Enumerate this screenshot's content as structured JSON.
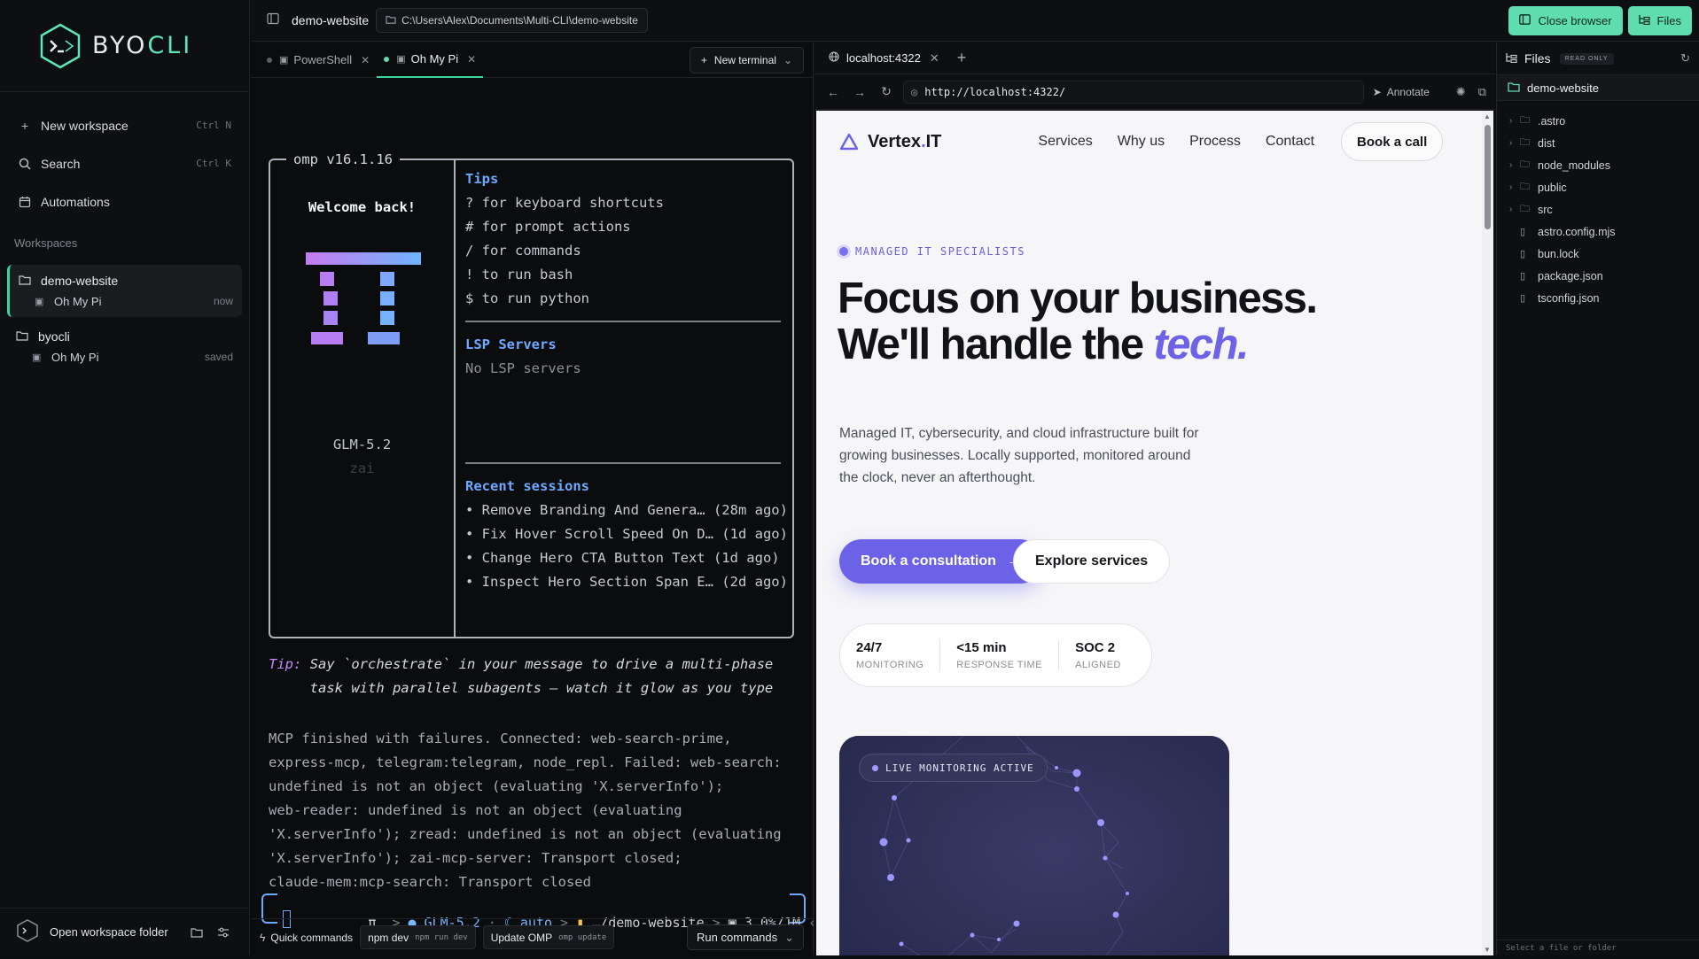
{
  "brand": {
    "name": "BYOCLI",
    "name_main": "BYO",
    "name_accent": "CLI",
    "accent_color": "#5ee6b7"
  },
  "sidebar": {
    "menu": [
      {
        "label": "New workspace",
        "shortcut": "Ctrl N",
        "icon": "plus-icon"
      },
      {
        "label": "Search",
        "shortcut": "Ctrl K",
        "icon": "search-icon"
      },
      {
        "label": "Automations",
        "shortcut": "",
        "icon": "calendar-icon"
      }
    ],
    "section_title": "Workspaces",
    "workspaces": [
      {
        "name": "demo-website",
        "session": "Oh My Pi",
        "meta": "now",
        "active": true
      },
      {
        "name": "byocli",
        "session": "Oh My Pi",
        "meta": "saved",
        "active": false
      }
    ],
    "footer_label": "Open workspace folder"
  },
  "topbar": {
    "project": "demo-website",
    "path": "C:\\Users\\Alex\\Documents\\Multi-CLI\\demo-website",
    "close_browser": "Close browser",
    "files": "Files"
  },
  "terminal": {
    "tabs": [
      {
        "label": "PowerShell",
        "active": false
      },
      {
        "label": "Oh My Pi",
        "active": true
      }
    ],
    "new_terminal": "New terminal",
    "box_title": "omp v16.1.16",
    "welcome": "Welcome back!",
    "model": "GLM-5.2",
    "provider": "zai",
    "tips_title": "Tips",
    "tips": [
      "? for keyboard shortcuts",
      "# for prompt actions",
      "/ for commands",
      "! to run bash",
      "$ to run python"
    ],
    "lsp_title": "LSP Servers",
    "lsp_none": "No LSP servers",
    "recent_title": "Recent sessions",
    "recent": [
      "• Remove Branding And Genera… (28m ago)",
      "• Fix Hover Scroll Speed On D… (1d ago)",
      "• Change Hero CTA Button Text (1d ago)",
      "• Inspect Hero Section Span E… (2d ago)"
    ],
    "tip_label": "Tip:",
    "tip_line1": " Say `orchestrate` in your message to drive a multi-phase",
    "tip_line2": "     task with parallel subagents — watch it glow as you type",
    "mcp_lines": [
      "MCP finished with failures. Connected: web-search-prime,",
      "express-mcp, telegram:telegram, node_repl. Failed: web-search:",
      "undefined is not an object (evaluating 'X.serverInfo');",
      "web-reader: undefined is not an object (evaluating",
      "'X.serverInfo'); zread: undefined is not an object (evaluating",
      "'X.serverInfo'); zai-mcp-server: Transport closed;",
      "claude-mem:mcp-search: Transport closed"
    ],
    "status": {
      "pi": "π",
      "model": "GLM-5.2",
      "mode": "auto",
      "dir": "…/demo-website",
      "context": "3.0%/1M"
    },
    "footer": {
      "quick_commands": "Quick commands",
      "chips": [
        {
          "label": "npm dev",
          "sub": "npm run dev"
        },
        {
          "label": "Update OMP",
          "sub": "omp update"
        }
      ],
      "run_commands": "Run commands"
    }
  },
  "browser": {
    "tab_label": "localhost:4322",
    "url": "http://localhost:4322/",
    "annotate": "Annotate"
  },
  "site": {
    "logo_main": "Vertex",
    "logo_dot": ".",
    "logo_tail": "IT",
    "nav": [
      "Services",
      "Why us",
      "Process",
      "Contact"
    ],
    "book_call": "Book a call",
    "eyebrow": "MANAGED IT SPECIALISTS",
    "headline_1": "Focus on your business.",
    "headline_2": "We'll handle the ",
    "headline_em": "tech.",
    "lede": "Managed IT, cybersecurity, and cloud infrastructure built for growing businesses. Locally supported, monitored around the clock, never an afterthought.",
    "cta_primary": "Book a consultation",
    "cta_secondary": "Explore services",
    "stats": [
      {
        "value": "24/7",
        "label": "MONITORING"
      },
      {
        "value": "<15 min",
        "label": "RESPONSE TIME"
      },
      {
        "value": "SOC 2",
        "label": "ALIGNED"
      }
    ],
    "live_chip": "LIVE MONITORING ACTIVE",
    "accent": "#6c62e8"
  },
  "files": {
    "title": "Files",
    "badge": "READ ONLY",
    "root": "demo-website",
    "folders": [
      ".astro",
      "dist",
      "node_modules",
      "public",
      "src"
    ],
    "files": [
      "astro.config.mjs",
      "bun.lock",
      "package.json",
      "tsconfig.json"
    ],
    "footer": "Select a file or folder"
  }
}
